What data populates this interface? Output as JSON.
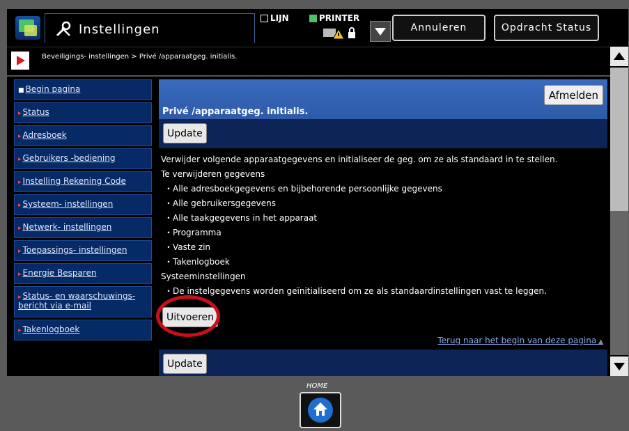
{
  "header": {
    "title": "Instellingen",
    "lijn_label": "LIJN",
    "printer_label": "PRINTER",
    "cancel_label": "Annuleren",
    "job_status_label": "Opdracht Status"
  },
  "breadcrumb": "Beveiligings- instellingen > Privé /apparaatgeg. initialis.",
  "sidebar": {
    "items": [
      {
        "label": "Begin pagina"
      },
      {
        "label": "Status"
      },
      {
        "label": "Adresboek"
      },
      {
        "label": "Gebruikers -bediening"
      },
      {
        "label": "Instelling Rekening Code"
      },
      {
        "label": "Systeem- instellingen"
      },
      {
        "label": "Netwerk- instellingen"
      },
      {
        "label": "Toepassings- instellingen"
      },
      {
        "label": "Energie Besparen"
      },
      {
        "label": "Status- en waarschuwings- bericht via e-mail"
      },
      {
        "label": "Takenlogboek"
      }
    ]
  },
  "main": {
    "logout_label": "Afmelden",
    "page_title": "Privé /apparaatgeg. initialis.",
    "update_label": "Update",
    "update_label_bottom": "Update",
    "intro": "Verwijder volgende apparaatgegevens en initialiseer de geg. om ze als standaard in te stellen.",
    "delete_heading": "Te verwijderen gegevens",
    "delete_items": [
      "・Alle adresboekgegevens en bijbehorende persoonlijke gegevens",
      "・Alle gebruikersgegevens",
      "・Alle taakgegevens in het apparaat",
      "・Programma",
      "・Vaste zin",
      "・Takenlogboek"
    ],
    "system_heading": "Systeeminstellingen",
    "system_item": "・De instelgegevens worden geïnitialiseerd om ze als standaardinstellingen vast te leggen.",
    "execute_label": "Uitvoeren",
    "back_to_top": "Terug naar het begin van deze pagina"
  },
  "home": {
    "label": "HOME"
  },
  "colors": {
    "accent_blue": "#2e5aa8",
    "nav_bg": "#062a66",
    "highlight_red": "#c8101a"
  }
}
